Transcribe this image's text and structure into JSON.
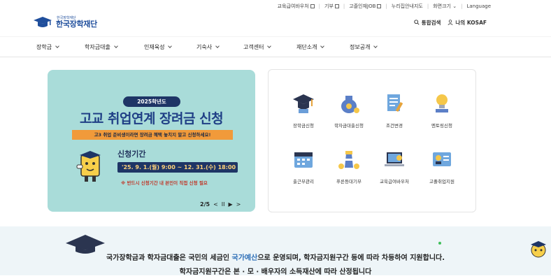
{
  "util": {
    "links": [
      "교육급여바우처",
      "기부",
      "고졸인재JOB",
      "누리집안내지도",
      "화면크기",
      "Language"
    ]
  },
  "logo": {
    "small": "한국장학재단",
    "main": "한국장학재단"
  },
  "header": {
    "search": "통합검색",
    "my": "나의 KOSAF"
  },
  "gnb": {
    "items": [
      "장학금",
      "학자금대출",
      "인재육성",
      "기숙사",
      "고객센터",
      "재단소개",
      "정보공개"
    ]
  },
  "banner": {
    "year": "2025학년도",
    "title": "고교 취업연계 장려금 신청",
    "sub": "고3 취업 준비생이라면 장려금 혜택 놓치지 말고 신청하세요!",
    "period_label": "신청기간",
    "period": "'25. 9. 1.(월) 9:00 ~ 12. 31.(수) 18:00",
    "note": "※ 반드시 신청기간 내 본인이 직접 신청 필요",
    "page": "2/5",
    "prev": "<",
    "pause": "II",
    "play": "▶",
    "next": ">"
  },
  "quick": {
    "items": [
      {
        "label": "장학금신청",
        "icon": "graduation-cap-icon"
      },
      {
        "label": "학자금대출신청",
        "icon": "money-bag-icon"
      },
      {
        "label": "조건변경",
        "icon": "document-pen-icon"
      },
      {
        "label": "멘토링신청",
        "icon": "lightbulb-icon"
      },
      {
        "label": "출근부관리",
        "icon": "calendar-icon"
      },
      {
        "label": "푸른등대기부",
        "icon": "lighthouse-icon"
      },
      {
        "label": "교육급여바우처",
        "icon": "laptop-icon"
      },
      {
        "label": "고졸취업지원",
        "icon": "id-card-icon"
      }
    ]
  },
  "info": {
    "line1_a": "국가장학금과 학자금대출은 국민의 세금인 ",
    "line1_hl": "국가예산",
    "line1_b": "으로 운영되며, 학자금지원구간 등에 따라 차등하여 지원합니다.",
    "line2": "학자금지원구간은 본 · 모 · 배우자의 소득재산에 따라 산정됩니다"
  },
  "colors": {
    "brand": "#1f4e9c",
    "banner_bg": "#a9dcd9",
    "banner_navy": "#1e3566",
    "banner_orange": "#f19a3a",
    "info_bg": "#eef5f8"
  }
}
